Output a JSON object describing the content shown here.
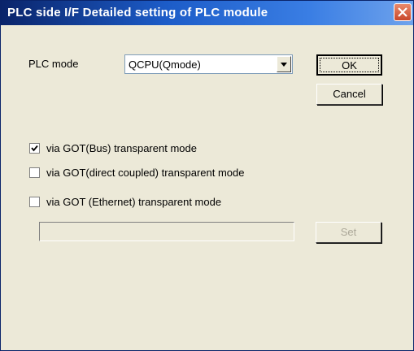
{
  "window": {
    "title": "PLC side I/F   Detailed setting of PLC module"
  },
  "form": {
    "plc_mode_label": "PLC mode",
    "plc_mode_value": "QCPU(Qmode)"
  },
  "buttons": {
    "ok": "OK",
    "cancel": "Cancel",
    "set": "Set"
  },
  "options": [
    {
      "label": "via GOT(Bus) transparent mode",
      "checked": true
    },
    {
      "label": "via GOT(direct coupled) transparent mode",
      "checked": false
    },
    {
      "label": "via GOT (Ethernet) transparent mode",
      "checked": false
    }
  ],
  "ethernet_field": {
    "value": "",
    "enabled": false
  },
  "colors": {
    "titlebar_start": "#0a246a",
    "titlebar_end": "#6fa3ec",
    "dialog_bg": "#ece9d8",
    "close_button": "#c9472b"
  }
}
